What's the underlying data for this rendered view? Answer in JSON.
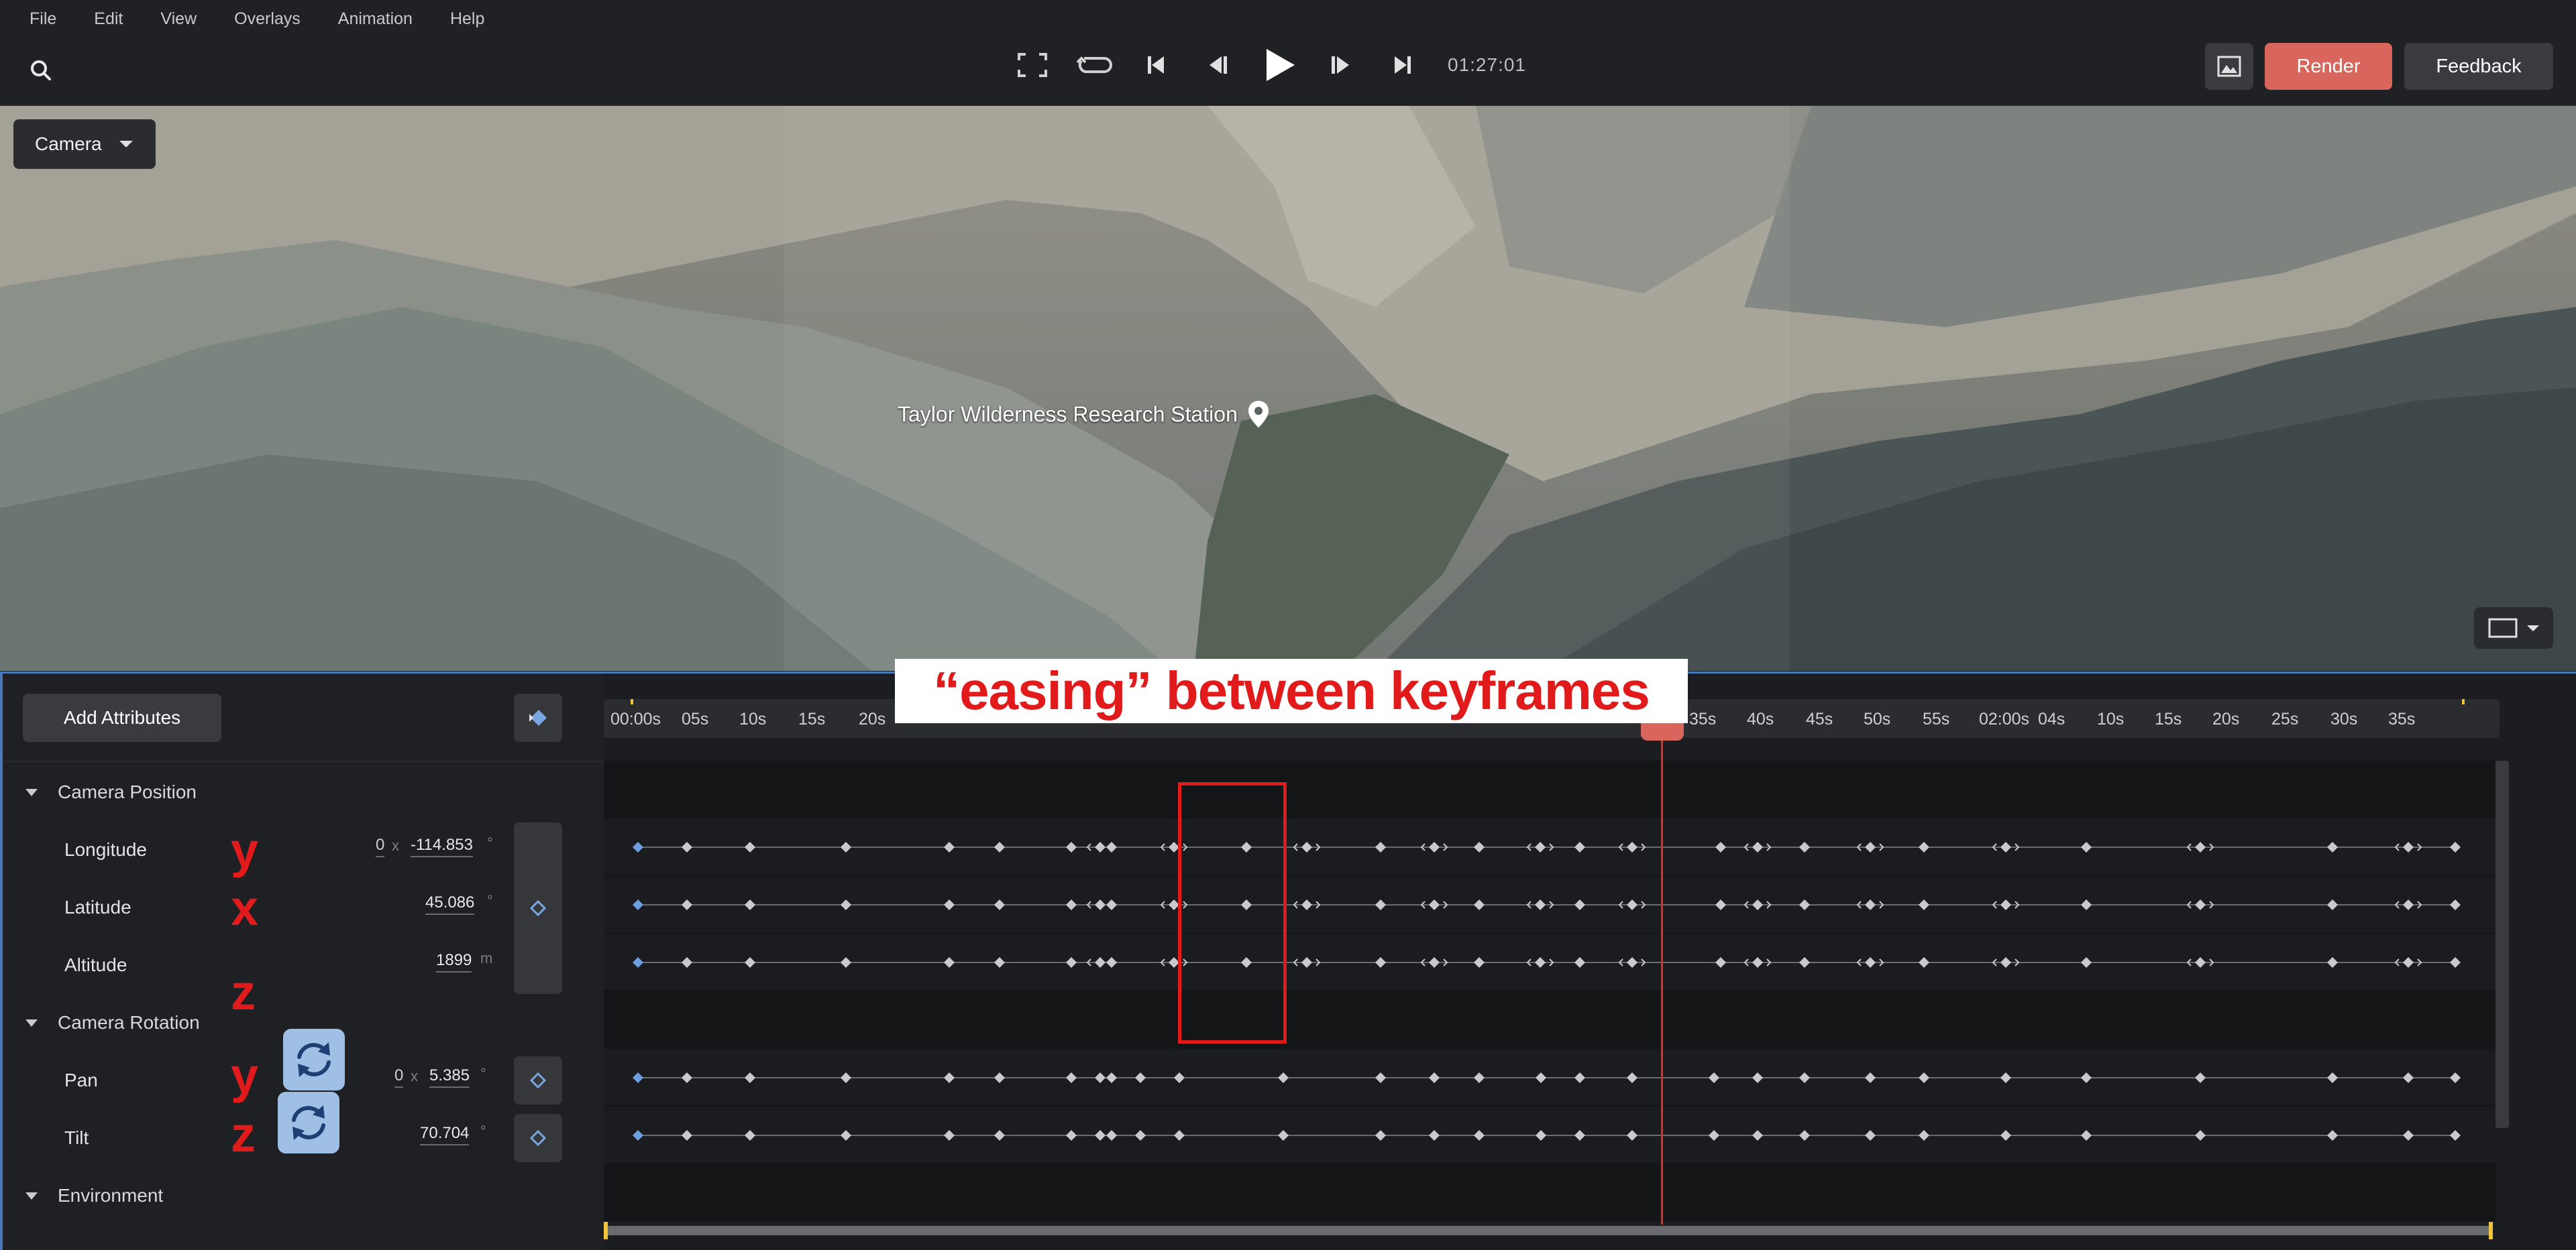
{
  "menu": [
    "File",
    "Edit",
    "View",
    "Overlays",
    "Animation",
    "Help"
  ],
  "transport": {
    "timecode": "01:27:01"
  },
  "buttons": {
    "render": "Render",
    "feedback": "Feedback",
    "add_attributes": "Add Attributes"
  },
  "viewport": {
    "camera_dropdown": "Camera",
    "place_label": "Taylor Wilderness Research Station"
  },
  "timeline": {
    "ticks": [
      "00:00s",
      "05s",
      "10s",
      "15s",
      "20s",
      "35s",
      "40s",
      "45s",
      "50s",
      "55s",
      "02:00s",
      "04s",
      "10s",
      "15s",
      "20s",
      "25s",
      "30s",
      "35s"
    ]
  },
  "groups": {
    "camera_position": "Camera Position",
    "camera_rotation": "Camera Rotation",
    "environment": "Environment"
  },
  "attributes": {
    "longitude": {
      "label": "Longitude",
      "offset": "0",
      "mult": "x",
      "value": "-114.853",
      "unit": "°"
    },
    "latitude": {
      "label": "Latitude",
      "value": "45.086",
      "unit": "°"
    },
    "altitude": {
      "label": "Altitude",
      "value": "1899",
      "unit": "m"
    },
    "pan": {
      "label": "Pan",
      "offset": "0",
      "mult": "x",
      "value": "5.385",
      "unit": "°"
    },
    "tilt": {
      "label": "Tilt",
      "value": "70.704",
      "unit": "°"
    }
  },
  "annotations": {
    "easing": "“easing” between keyframes",
    "axis_letters": [
      "y",
      "x",
      "z",
      "y",
      "z"
    ]
  },
  "colors": {
    "render": "#d9665c",
    "accent": "#4b78b8",
    "annotation": "#e11b1b",
    "playhead": "#d9665c"
  }
}
